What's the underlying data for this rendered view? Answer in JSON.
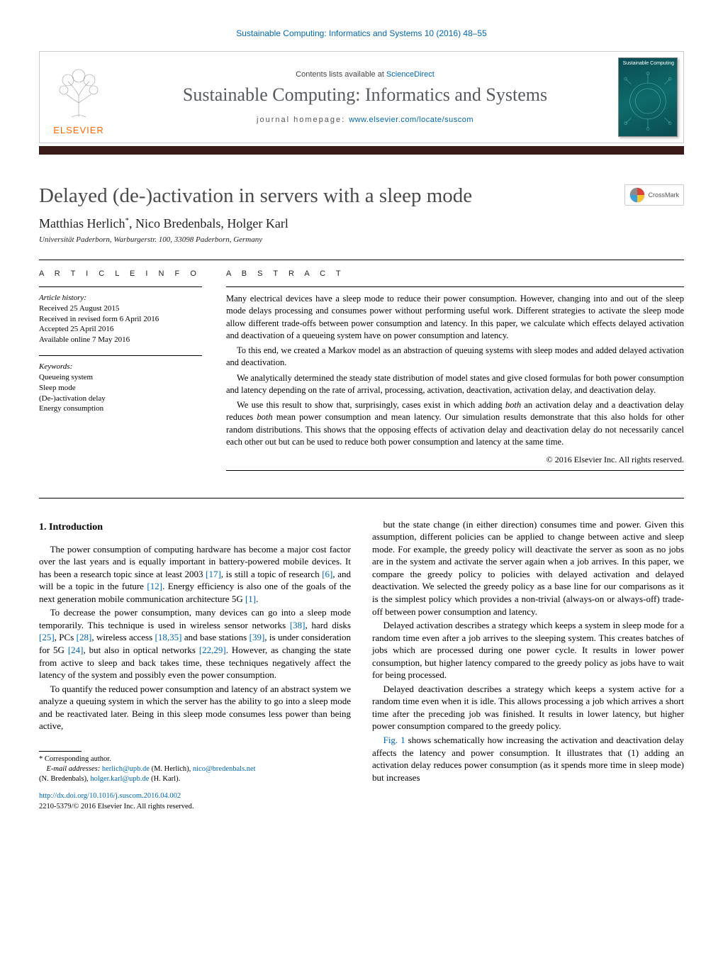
{
  "running_head": "Sustainable Computing: Informatics and Systems 10 (2016) 48–55",
  "banner": {
    "publisher_name": "ELSEVIER",
    "contents_prefix": "Contents lists available at ",
    "contents_link": "ScienceDirect",
    "journal_name": "Sustainable Computing: Informatics and Systems",
    "homepage_prefix": "journal homepage: ",
    "homepage_link": "www.elsevier.com/locate/suscom",
    "cover_label": "Sustainable\nComputing"
  },
  "crossmark_label": "CrossMark",
  "article": {
    "title": "Delayed (de-)activation in servers with a sleep mode",
    "authors_html": "Matthias Herlich*, Nico Bredenbals, Holger Karl",
    "author_1": "Matthias Herlich",
    "author_mark": "*",
    "author_2": ", Nico Bredenbals, Holger Karl",
    "affiliation": "Universität Paderborn, Warburgerstr. 100, 33098 Paderborn, Germany"
  },
  "info": {
    "head": "A R T I C L E   I N F O",
    "history_label": "Article history:",
    "received": "Received 25 August 2015",
    "revised": "Received in revised form 6 April 2016",
    "accepted": "Accepted 25 April 2016",
    "online": "Available online 7 May 2016",
    "keywords_label": "Keywords:",
    "kw1": "Queueing system",
    "kw2": "Sleep mode",
    "kw3": "(De-)activation delay",
    "kw4": "Energy consumption"
  },
  "abstract": {
    "head": "A B S T R A C T",
    "p1": "Many electrical devices have a sleep mode to reduce their power consumption. However, changing into and out of the sleep mode delays processing and consumes power without performing useful work. Different strategies to activate the sleep mode allow different trade-offs between power consumption and latency. In this paper, we calculate which effects delayed activation and deactivation of a queueing system have on power consumption and latency.",
    "p2": "To this end, we created a Markov model as an abstraction of queuing systems with sleep modes and added delayed activation and deactivation.",
    "p3": "We analytically determined the steady state distribution of model states and give closed formulas for both power consumption and latency depending on the rate of arrival, processing, activation, deactivation, activation delay, and deactivation delay.",
    "p4a": "We use this result to show that, surprisingly, cases exist in which adding ",
    "p4b": "both",
    "p4c": " an activation delay and a deactivation delay reduces ",
    "p4d": "both",
    "p4e": " mean power consumption and mean latency. Our simulation results demonstrate that this also holds for other random distributions. This shows that the opposing effects of activation delay and deactivation delay do not necessarily cancel each other out but can be used to reduce both power consumption and latency at the same time.",
    "copyright": "© 2016 Elsevier Inc. All rights reserved."
  },
  "body": {
    "h1": "1. Introduction",
    "l1a": "The power consumption of computing hardware has become a major cost factor over the last years and is equally important in battery-powered mobile devices. It has been a research topic since at least 2003 ",
    "r17": "[17]",
    "l1b": ", is still a topic of research ",
    "r6": "[6]",
    "l1c": ", and will be a topic in the future ",
    "r12": "[12]",
    "l1d": ". Energy efficiency is also one of the goals of the next generation mobile communication architecture 5G ",
    "r1": "[1]",
    "l1e": ".",
    "l2a": "To decrease the power consumption, many devices can go into a sleep mode temporarily. This technique is used in wireless sensor networks ",
    "r38": "[38]",
    "l2b": ", hard disks ",
    "r25": "[25]",
    "l2c": ", PCs ",
    "r28": "[28]",
    "l2d": ", wireless access ",
    "r1835": "[18,35]",
    "l2e": " and base stations ",
    "r39": "[39]",
    "l2f": ", is under consideration for 5G ",
    "r24": "[24]",
    "l2g": ", but also in optical networks ",
    "r2229": "[22,29]",
    "l2h": ". However, as changing the state from active to sleep and back takes time, these techniques negatively affect the latency of the system and possibly even the power consumption.",
    "l3": "To quantify the reduced power consumption and latency of an abstract system we analyze a queuing system in which the server has the ability to go into a sleep mode and be reactivated later. Being in this sleep mode consumes less power than being active,",
    "r1txt": "but the state change (in either direction) consumes time and power. Given this assumption, different policies can be applied to change between active and sleep mode. For example, the greedy policy will deactivate the server as soon as no jobs are in the system and activate the server again when a job arrives. In this paper, we compare the greedy policy to policies with delayed activation and delayed deactivation. We selected the greedy policy as a base line for our comparisons as it is the simplest policy which provides a non-trivial (always-on or always-off) trade-off between power consumption and latency.",
    "r2txt": "Delayed activation describes a strategy which keeps a system in sleep mode for a random time even after a job arrives to the sleeping system. This creates batches of jobs which are processed during one power cycle. It results in lower power consumption, but higher latency compared to the greedy policy as jobs have to wait for being processed.",
    "r3txt": "Delayed deactivation describes a strategy which keeps a system active for a random time even when it is idle. This allows processing a job which arrives a short time after the preceding job was finished. It results in lower latency, but higher power consumption compared to the greedy policy.",
    "r4a": "",
    "fig1": "Fig. 1",
    "r4b": " shows schematically how increasing the activation and deactivation delay affects the latency and power consumption. It illustrates that (1) adding an activation delay reduces power consumption (as it spends more time in sleep mode) but increases"
  },
  "footnotes": {
    "corresp": "* Corresponding author.",
    "emails_label": "E-mail addresses: ",
    "e1": "herlich@upb.de",
    "e1p": " (M. Herlich), ",
    "e2": "nico@bredenbals.net",
    "e2p": " (N. Bredenbals), ",
    "e3": "holger.karl@upb.de",
    "e3p": " (H. Karl)."
  },
  "doi": {
    "link": "http://dx.doi.org/10.1016/j.suscom.2016.04.002",
    "issn": "2210-5379/© 2016 Elsevier Inc. All rights reserved."
  }
}
